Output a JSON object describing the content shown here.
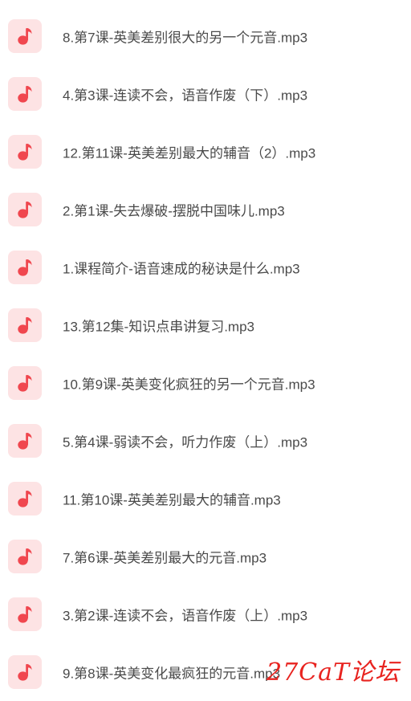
{
  "files": [
    {
      "name": "8.第7课-英美差别很大的另一个元音.mp3",
      "icon": "music-note-icon"
    },
    {
      "name": "4.第3课-连读不会，语音作废（下）.mp3",
      "icon": "music-note-icon"
    },
    {
      "name": "12.第11课-英美差别最大的辅音（2）.mp3",
      "icon": "music-note-icon"
    },
    {
      "name": "2.第1课-失去爆破-摆脱中国味儿.mp3",
      "icon": "music-note-icon"
    },
    {
      "name": "1.课程简介-语音速成的秘诀是什么.mp3",
      "icon": "music-note-icon"
    },
    {
      "name": "13.第12集-知识点串讲复习.mp3",
      "icon": "music-note-icon"
    },
    {
      "name": "10.第9课-英美变化疯狂的另一个元音.mp3",
      "icon": "music-note-icon"
    },
    {
      "name": "5.第4课-弱读不会，听力作废（上）.mp3",
      "icon": "music-note-icon"
    },
    {
      "name": "11.第10课-英美差别最大的辅音.mp3",
      "icon": "music-note-icon"
    },
    {
      "name": "7.第6课-英美差别最大的元音.mp3",
      "icon": "music-note-icon"
    },
    {
      "name": "3.第2课-连读不会，语音作废（上）.mp3",
      "icon": "music-note-icon"
    },
    {
      "name": "9.第8课-英美变化最疯狂的元音.mp3",
      "icon": "music-note-icon"
    }
  ],
  "watermark": "27CaT论坛",
  "colors": {
    "icon_bg": "#fde3e4",
    "icon_fg": "#f0474f",
    "text": "#4a4a4a",
    "watermark": "#e8231f"
  }
}
